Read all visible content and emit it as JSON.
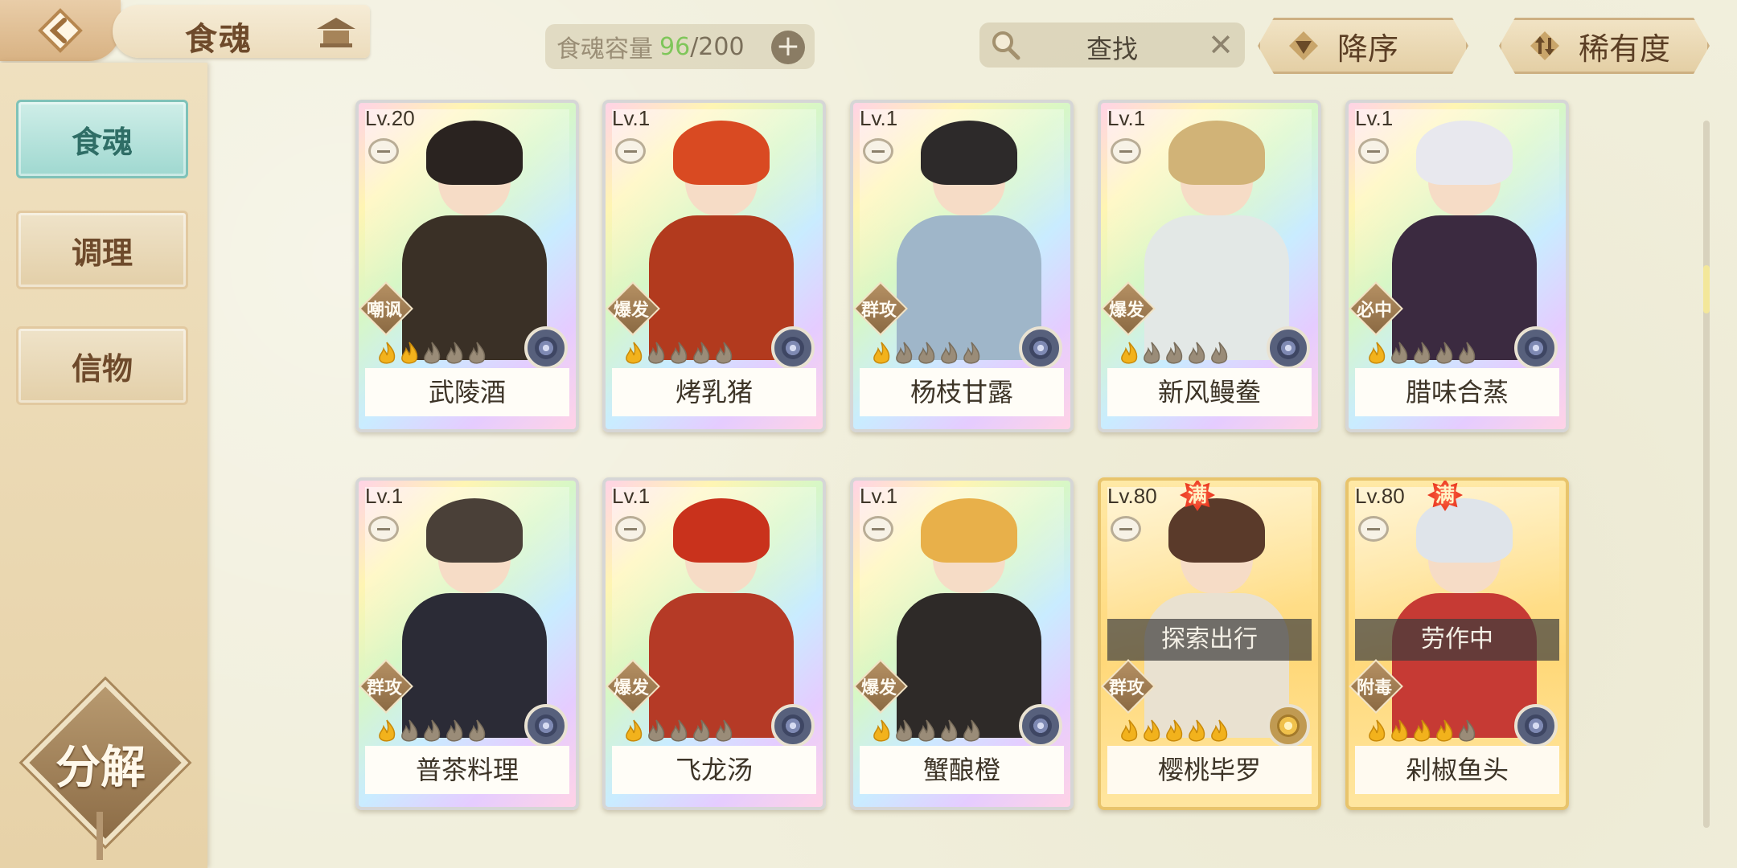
{
  "header": {
    "title": "食魂",
    "capacity_label": "食魂容量",
    "capacity_current": "96",
    "capacity_sep": "/",
    "capacity_max": "200",
    "capacity_add": "+",
    "search_placeholder": "查找",
    "search_clear": "✕",
    "sort_order_label": "降序",
    "sort_rarity_label": "稀有度"
  },
  "sidebar": {
    "tabs": [
      {
        "label": "食魂",
        "active": true
      },
      {
        "label": "调理",
        "active": false
      },
      {
        "label": "信物",
        "active": false
      }
    ],
    "decompose_label": "分解"
  },
  "cards": [
    {
      "level": "Lv.20",
      "name": "武陵酒",
      "role": "嘲讽",
      "stars": 2,
      "hair": "#2a2320",
      "body": "#3a3026",
      "full": false,
      "status": null,
      "gold": false
    },
    {
      "level": "Lv.1",
      "name": "烤乳猪",
      "role": "爆发",
      "stars": 1,
      "hair": "#d94a22",
      "body": "#b23a1e",
      "full": false,
      "status": null,
      "gold": false
    },
    {
      "level": "Lv.1",
      "name": "杨枝甘露",
      "role": "群攻",
      "stars": 1,
      "hair": "#2d2a2a",
      "body": "#9fb6c9",
      "full": false,
      "status": null,
      "gold": false
    },
    {
      "level": "Lv.1",
      "name": "新风鳗鲞",
      "role": "爆发",
      "stars": 1,
      "hair": "#d1b377",
      "body": "#e3e8e6",
      "full": false,
      "status": null,
      "gold": false
    },
    {
      "level": "Lv.1",
      "name": "腊味合蒸",
      "role": "必中",
      "stars": 1,
      "hair": "#e8e8ee",
      "body": "#3b2a40",
      "full": false,
      "status": null,
      "gold": false
    },
    {
      "level": "Lv.1",
      "name": "普茶料理",
      "role": "群攻",
      "stars": 1,
      "hair": "#4a4038",
      "body": "#2b2b36",
      "full": false,
      "status": null,
      "gold": false
    },
    {
      "level": "Lv.1",
      "name": "飞龙汤",
      "role": "爆发",
      "stars": 1,
      "hair": "#c9321c",
      "body": "#b53a26",
      "full": false,
      "status": null,
      "gold": false
    },
    {
      "level": "Lv.1",
      "name": "蟹酿橙",
      "role": "爆发",
      "stars": 1,
      "hair": "#e8b04a",
      "body": "#2e2a28",
      "full": false,
      "status": null,
      "gold": false
    },
    {
      "level": "Lv.80",
      "name": "樱桃毕罗",
      "role": "群攻",
      "stars": 5,
      "hair": "#5a3a2a",
      "body": "#e9e1d0",
      "full": true,
      "full_label": "满",
      "status": "探索出行",
      "gold": true
    },
    {
      "level": "Lv.80",
      "name": "剁椒鱼头",
      "role": "附毒",
      "stars": 4,
      "hair": "#dfe4ea",
      "body": "#c63a34",
      "full": true,
      "full_label": "满",
      "status": "劳作中",
      "gold": true
    }
  ],
  "colors": {
    "accent_teal": "#9fd8d0",
    "capacity_current": "#7fc65a",
    "full_badge": "#e9371f",
    "brown_text": "#6e4a2b"
  },
  "icons": [
    "back-arrow-icon",
    "home-pavilion-icon",
    "search-icon",
    "clear-icon",
    "sort-down-icon",
    "rarity-sort-icon",
    "flame-star-icon",
    "element-icon",
    "lock-icon"
  ]
}
